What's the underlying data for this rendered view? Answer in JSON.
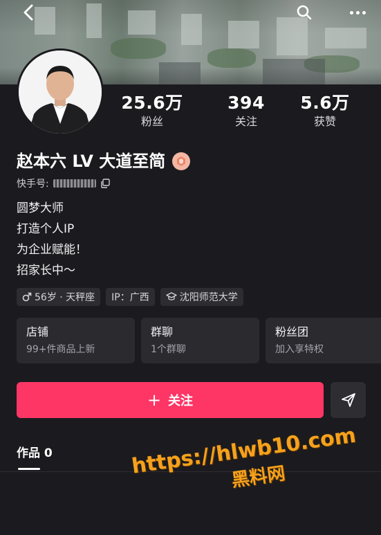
{
  "header": {
    "back_icon": "chevron-left-icon",
    "search_icon": "search-icon",
    "more_icon": "more-dots-icon"
  },
  "profile": {
    "name": "赵本六 LV 大道至简",
    "uid_label": "快手号:",
    "uid_value_masked": "",
    "badge_icon": "level-badge-icon"
  },
  "stats": [
    {
      "value": "25.6万",
      "label": "粉丝"
    },
    {
      "value": "394",
      "label": "关注"
    },
    {
      "value": "5.6万",
      "label": "获赞"
    }
  ],
  "bio": [
    "圆梦大师",
    "打造个人IP",
    "为企业赋能！",
    "招家长中～"
  ],
  "tags": [
    {
      "icon": "male-icon",
      "text": "56岁 · 天秤座"
    },
    {
      "icon": "",
      "text": "IP：广西"
    },
    {
      "icon": "graduation-cap-icon",
      "text": "沈阳师范大学"
    }
  ],
  "cards": [
    {
      "title": "店铺",
      "subtitle": "99+件商品上新"
    },
    {
      "title": "群聊",
      "subtitle": "1个群聊"
    },
    {
      "title": "粉丝团",
      "subtitle": "加入享特权"
    }
  ],
  "actions": {
    "follow_plus": "+",
    "follow_label": "关注",
    "share_icon": "send-icon"
  },
  "tabs": {
    "works_label": "作品 0"
  },
  "watermark": {
    "url": "https://hlwb10.com",
    "text": "黑料网"
  },
  "colors": {
    "background": "#1b1b1f",
    "follow_button": "#fe3666",
    "card_bg": "#2a2a2f",
    "watermark": "#f5a11c"
  }
}
